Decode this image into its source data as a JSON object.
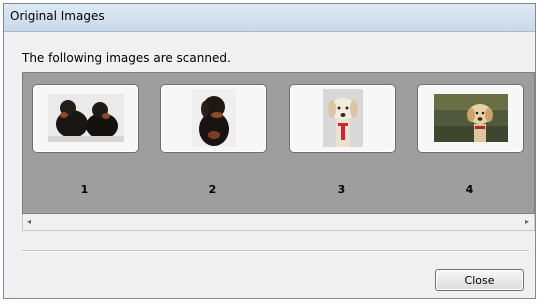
{
  "window": {
    "title": "Original Images"
  },
  "message": "The following images are scanned.",
  "thumbnails": [
    {
      "label": "1",
      "icon": "two-dogs-photo"
    },
    {
      "label": "2",
      "icon": "dachshund-photo"
    },
    {
      "label": "3",
      "icon": "white-dog-portrait-photo"
    },
    {
      "label": "4",
      "icon": "dog-in-garden-photo"
    }
  ],
  "scrollbar": {
    "left_arrow": "◂",
    "right_arrow": "▸"
  },
  "buttons": {
    "close": "Close"
  }
}
